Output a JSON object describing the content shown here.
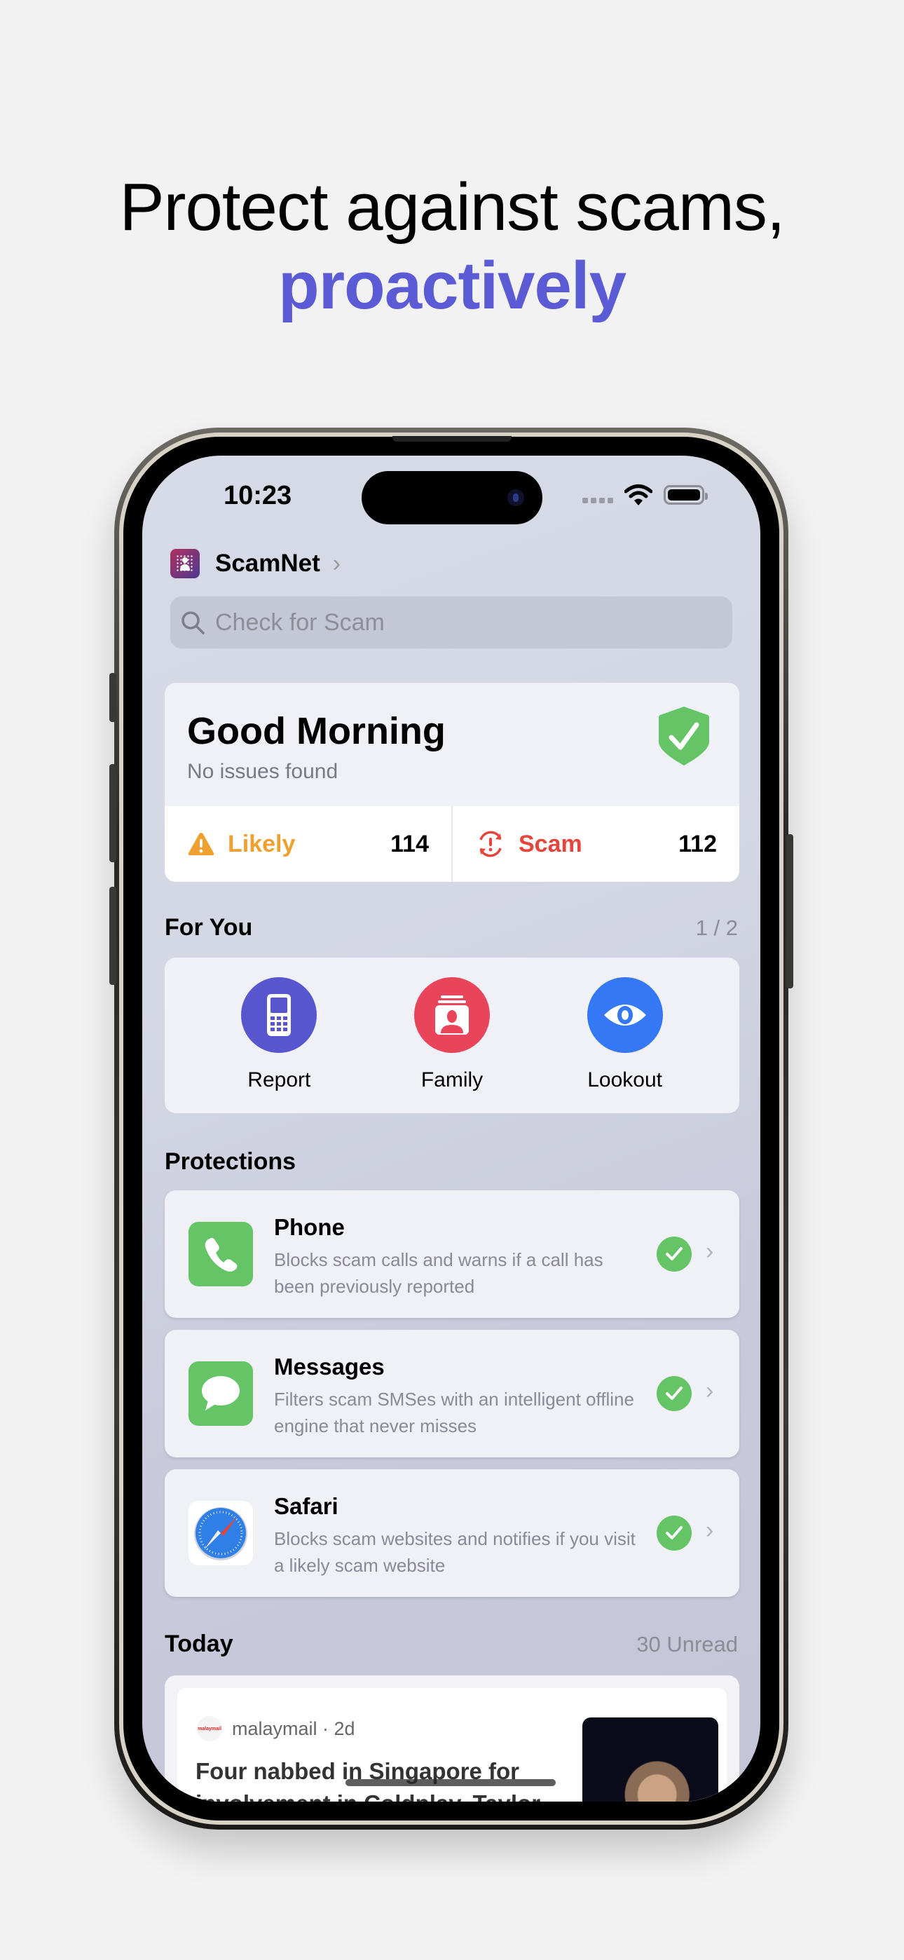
{
  "headline": {
    "line1": "Protect against scams,",
    "line2": "proactively",
    "accent_color": "#5b5bd6"
  },
  "status_bar": {
    "time": "10:23"
  },
  "app": {
    "name": "ScamNet",
    "chevron": "›"
  },
  "search": {
    "placeholder": "Check for Scam",
    "value": ""
  },
  "summary": {
    "greeting": "Good Morning",
    "status": "No issues found",
    "status_icon": "shield-check-icon",
    "stats": [
      {
        "label": "Likely",
        "value": "114",
        "icon": "warning-triangle-icon",
        "color": "#f0a030"
      },
      {
        "label": "Scam",
        "value": "112",
        "icon": "alert-cycle-icon",
        "color": "#e5453a"
      }
    ]
  },
  "for_you": {
    "title": "For You",
    "page": "1 / 2",
    "items": [
      {
        "label": "Report",
        "icon": "phone-keypad-icon",
        "color": "#5856cf"
      },
      {
        "label": "Family",
        "icon": "contact-card-icon",
        "color": "#e8445a"
      },
      {
        "label": "Lookout",
        "icon": "eye-icon",
        "color": "#3478f6"
      }
    ]
  },
  "protections": {
    "title": "Protections",
    "items": [
      {
        "title": "Phone",
        "description": "Blocks scam calls and warns if a call has been previously reported",
        "icon": "phone-icon",
        "enabled": true
      },
      {
        "title": "Messages",
        "description": "Filters scam SMSes with an intelligent offline engine that never misses",
        "icon": "message-bubble-icon",
        "enabled": true
      },
      {
        "title": "Safari",
        "description": "Blocks scam websites and notifies if you visit a likely scam website",
        "icon": "safari-compass-icon",
        "enabled": true
      }
    ]
  },
  "today": {
    "title": "Today",
    "unread": "30 Unread",
    "articles": [
      {
        "source": "malaymail · 2d",
        "source_logo": "malaymail",
        "headline": "Four nabbed in Singapore for involvement in Coldplay, Taylor"
      }
    ]
  }
}
